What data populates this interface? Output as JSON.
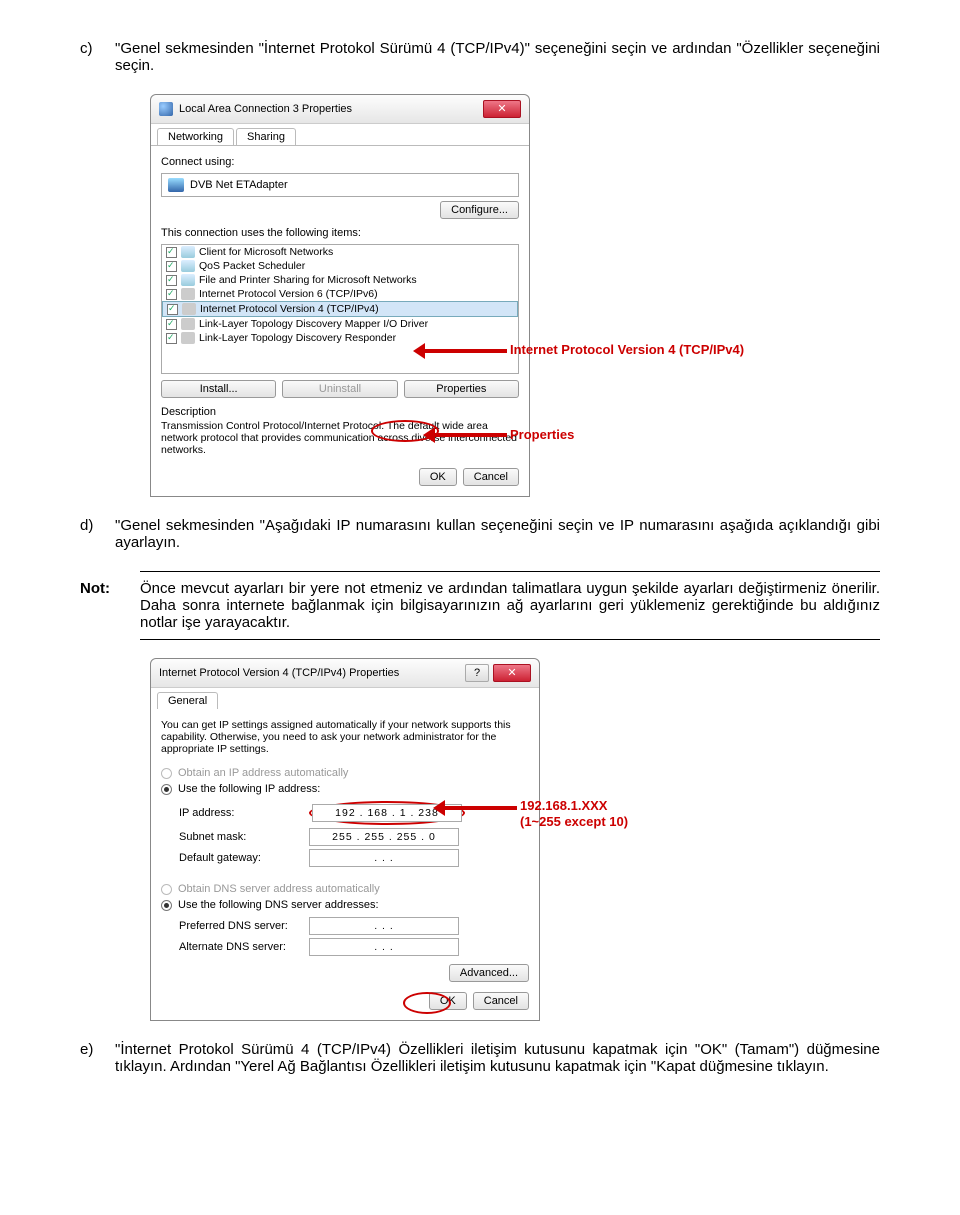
{
  "step_c": {
    "label": "c)",
    "text": "\"Genel sekmesinden \"İnternet Protokol Sürümü 4 (TCP/IPv4)\" seçeneğini seçin ve ardından \"Özellikler seçeneğini seçin."
  },
  "dialog1": {
    "title": "Local Area Connection 3 Properties",
    "tab_networking": "Networking",
    "tab_sharing": "Sharing",
    "connect_using": "Connect using:",
    "adapter": "DVB Net ETAdapter",
    "configure": "Configure...",
    "uses_items": "This connection uses the following items:",
    "items": [
      "Client for Microsoft Networks",
      "QoS Packet Scheduler",
      "File and Printer Sharing for Microsoft Networks",
      "Internet Protocol Version 6 (TCP/IPv6)",
      "Internet Protocol Version 4 (TCP/IPv4)",
      "Link-Layer Topology Discovery Mapper I/O Driver",
      "Link-Layer Topology Discovery Responder"
    ],
    "install": "Install...",
    "uninstall": "Uninstall",
    "properties": "Properties",
    "desc_label": "Description",
    "desc_text": "Transmission Control Protocol/Internet Protocol. The default wide area network protocol that provides communication across diverse interconnected networks.",
    "ok": "OK",
    "cancel": "Cancel"
  },
  "annot": {
    "ipv4": "Internet Protocol Version 4 (TCP/IPv4)",
    "properties": "Properties"
  },
  "step_d": {
    "label": "d)",
    "text": "\"Genel sekmesinden \"Aşağıdaki IP numarasını kullan seçeneğini seçin ve IP numarasını aşağıda açıklandığı gibi ayarlayın."
  },
  "note": {
    "label": "Not:",
    "text": "Önce mevcut ayarları bir yere not etmeniz ve ardından talimatlara uygun şekilde ayarları değiştirmeniz önerilir. Daha sonra internete bağlanmak için bilgisayarınızın ağ ayarlarını geri yüklemeniz gerektiğinde bu aldığınız notlar işe yarayacaktır."
  },
  "dialog2": {
    "title": "Internet Protocol Version 4 (TCP/IPv4) Properties",
    "tab_general": "General",
    "intro": "You can get IP settings assigned automatically if your network supports this capability. Otherwise, you need to ask your network administrator for the appropriate IP settings.",
    "radio_auto_ip": "Obtain an IP address automatically",
    "radio_use_ip": "Use the following IP address:",
    "ip_address_label": "IP address:",
    "ip_address_value": "192 . 168 .  1  . 238",
    "subnet_label": "Subnet mask:",
    "subnet_value": "255 . 255 . 255 .  0",
    "gateway_label": "Default gateway:",
    "gateway_value": ".       .       .",
    "radio_auto_dns": "Obtain DNS server address automatically",
    "radio_use_dns": "Use the following DNS server addresses:",
    "pref_dns_label": "Preferred DNS server:",
    "alt_dns_label": "Alternate DNS server:",
    "dns_blank": ".       .       .",
    "advanced": "Advanced...",
    "ok": "OK",
    "cancel": "Cancel"
  },
  "annot2": {
    "line1": "192.168.1.XXX",
    "line2": "(1~255 except 10)"
  },
  "step_e": {
    "label": "e)",
    "text": "\"İnternet Protokol Sürümü 4 (TCP/IPv4) Özellikleri iletişim kutusunu kapatmak için \"OK\" (Tamam\") düğmesine tıklayın. Ardından \"Yerel Ağ Bağlantısı Özellikleri iletişim kutusunu kapatmak için \"Kapat düğmesine tıklayın."
  }
}
